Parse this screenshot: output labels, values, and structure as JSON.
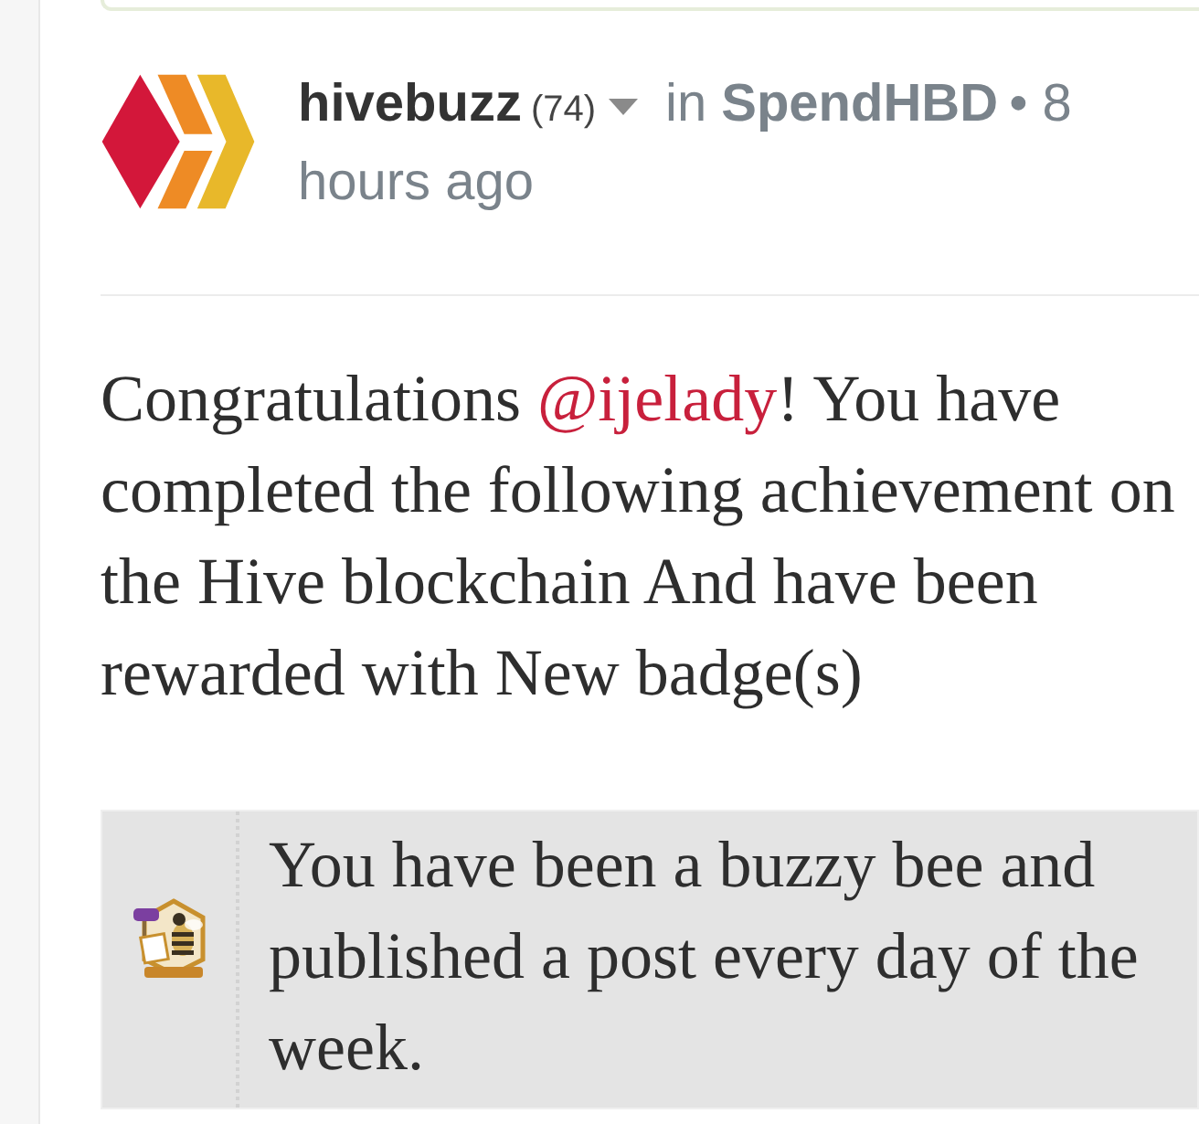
{
  "post_header": {
    "author": "hivebuzz",
    "reputation": "(74)",
    "preposition": "in",
    "community": "SpendHBD",
    "separator": "•",
    "time_lines": [
      "8",
      "hours ago"
    ]
  },
  "body": {
    "text_before": "Congratulations ",
    "mention": "@ijelady",
    "text_after": "! You have completed the following achievement on the Hive blockchain And have been rewarded with New badge(s)"
  },
  "badge_table": {
    "rows": [
      {
        "text": "You have been a buzzy bee and published a post every day of the week."
      }
    ]
  }
}
